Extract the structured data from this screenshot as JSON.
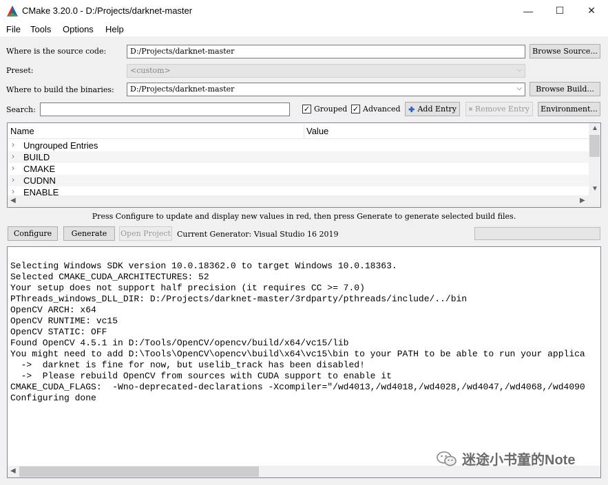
{
  "window": {
    "title": "CMake 3.20.0 - D:/Projects/darknet-master",
    "controls": {
      "minimize": "—",
      "maximize": "☐",
      "close": "✕"
    }
  },
  "menu": [
    "File",
    "Tools",
    "Options",
    "Help"
  ],
  "form": {
    "source_label": "Where is the source code:",
    "source_value": "D:/Projects/darknet-master",
    "browse_source": "Browse Source...",
    "preset_label": "Preset:",
    "preset_value": "<custom>",
    "build_label": "Where to build the binaries:",
    "build_value": "D:/Projects/darknet-master",
    "browse_build": "Browse Build...",
    "search_label": "Search:",
    "search_value": "",
    "grouped_label": "Grouped",
    "grouped_checked": true,
    "advanced_label": "Advanced",
    "advanced_checked": true,
    "add_entry": "Add Entry",
    "remove_entry": "Remove Entry",
    "environment": "Environment..."
  },
  "tree": {
    "columns": [
      "Name",
      "Value"
    ],
    "rows": [
      "Ungrouped Entries",
      "BUILD",
      "CMAKE",
      "CUDNN",
      "ENABLE"
    ]
  },
  "hint": "Press Configure to update and display new values in red, then press Generate to generate selected build files.",
  "actions": {
    "configure": "Configure",
    "generate": "Generate",
    "open_project": "Open Project",
    "generator_text": "Current Generator: Visual Studio 16 2019"
  },
  "output": [
    "Selecting Windows SDK version 10.0.18362.0 to target Windows 10.0.18363.",
    "Selected CMAKE_CUDA_ARCHITECTURES: 52",
    "Your setup does not support half precision (it requires CC >= 7.0)",
    "PThreads_windows_DLL_DIR: D:/Projects/darknet-master/3rdparty/pthreads/include/../bin",
    "OpenCV ARCH: x64",
    "OpenCV RUNTIME: vc15",
    "OpenCV STATIC: OFF",
    "Found OpenCV 4.5.1 in D:/Tools/OpenCV/opencv/build/x64/vc15/lib",
    "You might need to add D:\\Tools\\OpenCV\\opencv\\build\\x64\\vc15\\bin to your PATH to be able to run your applica",
    "  ->  darknet is fine for now, but uselib_track has been disabled!",
    "  ->  Please rebuild OpenCV from sources with CUDA support to enable it",
    "CMAKE_CUDA_FLAGS:  -Wno-deprecated-declarations -Xcompiler=\"/wd4013,/wd4018,/wd4028,/wd4047,/wd4068,/wd4090",
    "Configuring done"
  ],
  "watermark": "迷途小书童的Note",
  "colors": {
    "accent_blue": "#2a5ec8",
    "remove_gray": "#9a9a9a"
  }
}
